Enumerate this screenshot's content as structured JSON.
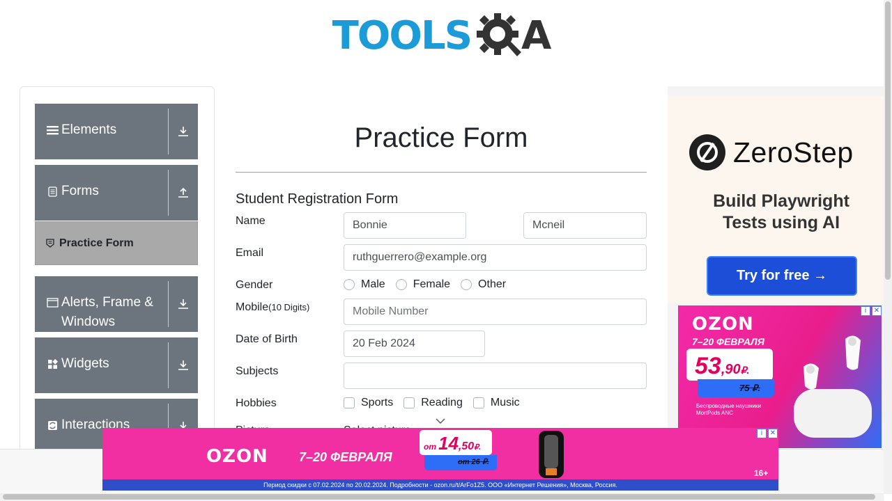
{
  "header": {
    "logo_text": "TOOLS",
    "logo_suffix": "A"
  },
  "sidebar": {
    "groups": [
      {
        "label": "Elements",
        "icon": "menu-icon",
        "arrow": "download-icon"
      },
      {
        "label": "Forms",
        "icon": "document-icon",
        "arrow": "upload-icon"
      },
      {
        "label": "Alerts, Frame & Windows",
        "icon": "window-icon",
        "arrow": "download-icon"
      },
      {
        "label": "Widgets",
        "icon": "widgets-icon",
        "arrow": "download-icon"
      },
      {
        "label": "Interactions",
        "icon": "interactions-icon",
        "arrow": "download-icon"
      }
    ],
    "active_item": {
      "label": "Practice Form",
      "icon": "clipboard-icon"
    }
  },
  "main": {
    "title": "Practice Form",
    "form_title": "Student Registration Form",
    "name": {
      "label": "Name",
      "first_value": "Bonnie",
      "last_value": "Mcneil"
    },
    "email": {
      "label": "Email",
      "value": "ruthguerrero@example.org"
    },
    "gender": {
      "label": "Gender",
      "options": [
        "Male",
        "Female",
        "Other"
      ]
    },
    "mobile": {
      "label": "Mobile",
      "hint": "(10 Digits)",
      "placeholder": "Mobile Number"
    },
    "dob": {
      "label": "Date of Birth",
      "value": "20 Feb 2024"
    },
    "subjects": {
      "label": "Subjects",
      "value": ""
    },
    "hobbies": {
      "label": "Hobbies",
      "options": [
        "Sports",
        "Reading",
        "Music"
      ]
    },
    "picture": {
      "label": "Picture",
      "select_text": "Select picture"
    }
  },
  "ads": {
    "zerostep": {
      "brand": "ZeroStep",
      "tagline_1": "Build Playwright",
      "tagline_2": "Tests using AI",
      "cta": "Try for free →"
    },
    "ozon_right": {
      "brand": "OZON",
      "dates": "7–20 ФЕВРАЛЯ",
      "price": "53",
      "price_cents": ",90",
      "currency": "₽.",
      "old_price": "75 ₽.",
      "product_1": "Беспроводные наушники",
      "product_2": "MortPods ANC"
    },
    "ozon_bottom": {
      "brand": "OZON",
      "dates": "7–20 ФЕВРАЛЯ",
      "price_prefix": "от",
      "price": "14",
      "price_cents": ",50",
      "currency": "₽.",
      "old_price": "от 26 ₽.",
      "age": "16+",
      "fine_print": "Период скидки с 07.02.2024 по 20.02.2024. Подробности - ozon.ru/t/ArFo1Z5. ООО «Интернет Решения», Москва, Россия."
    },
    "adchoice": {
      "info": "i",
      "close": "✕"
    }
  },
  "colors": {
    "sidebar_bg": "#6c757d",
    "active_item_bg": "#a9a9a9",
    "logo_blue": "#1b9bd8",
    "cta_blue": "#1d4ed8",
    "ozon_pink": "#f12fa3"
  }
}
